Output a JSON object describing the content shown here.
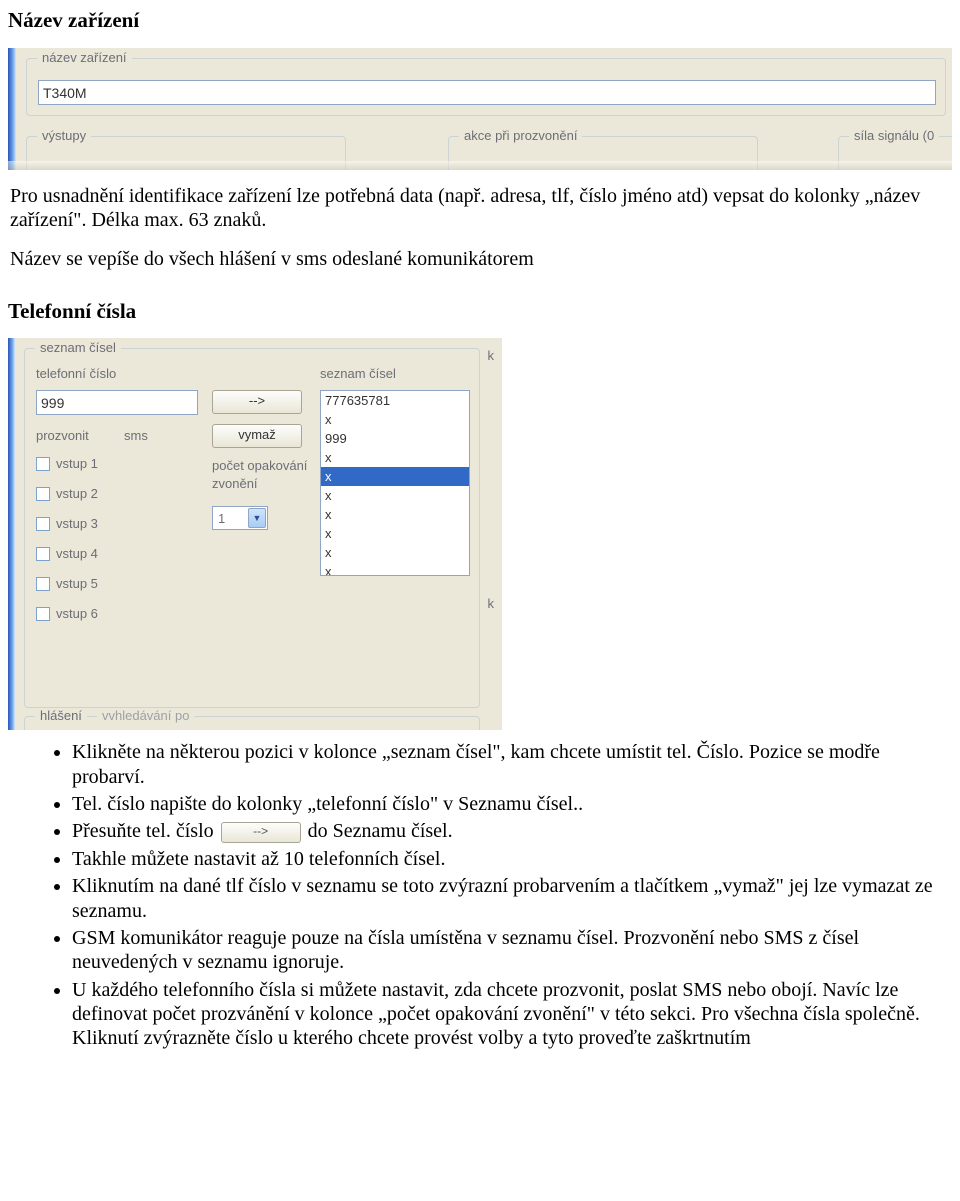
{
  "doc": {
    "h1": "Název zařízení",
    "p1": "Pro usnadnění identifikace zařízení lze potřebná data (např. adresa, tlf, číslo jméno atd) vepsat do kolonky „název zařízení\". Délka max. 63 znaků.",
    "p2": "Název se vepíše do všech hlášení v sms odeslané komunikátorem",
    "h2": "Telefonní čísla"
  },
  "shot1": {
    "group_label": "název zařízení",
    "device_name": "T340M",
    "group_outputs": "výstupy",
    "group_action": "akce při prozvonění",
    "group_signal": "síla signálu (0"
  },
  "shot2": {
    "group_label": "seznam čísel",
    "lbl_tel": "telefonní číslo",
    "lbl_list": "seznam čísel",
    "phone_input": "999",
    "lbl_call": "prozvonit",
    "lbl_sms": "sms",
    "btn_add": "-->",
    "btn_del": "vymaž",
    "lbl_repeat1": "počet opakování",
    "lbl_repeat2": "zvonění",
    "repeat_value": "1",
    "inputs": [
      "vstup 1",
      "vstup 2",
      "vstup 3",
      "vstup 4",
      "vstup 5",
      "vstup 6"
    ],
    "list": [
      "777635781",
      "x",
      "999",
      "x",
      "x",
      "x",
      "x",
      "x",
      "x",
      "x"
    ],
    "selected_index": 4,
    "lbl_bottom": "hlášení",
    "lbl_bottom2": "vvhledávání po",
    "right_k1": "k",
    "right_k2": "k"
  },
  "bullets": {
    "b1a": "Klikněte na některou pozici v kolonce „seznam čísel\", kam chcete umístit tel. Číslo. Pozice se modře probarví.",
    "b2": "Tel. číslo napište do kolonky „telefonní číslo\" v Seznamu čísel..",
    "b3_pre": "Přesuňte tel. číslo ",
    "b3_btn": "-->",
    "b3_post": " do  Seznamu čísel.",
    "b4": "Takhle můžete nastavit až 10 telefonních čísel.",
    "b5": "Kliknutím na dané tlf číslo v seznamu se toto zvýrazní probarvením a tlačítkem „vymaž\" jej lze vymazat ze seznamu.",
    "b6": "GSM komunikátor reaguje pouze na čísla umístěna v seznamu čísel. Prozvonění nebo SMS z čísel neuvedených v seznamu ignoruje.",
    "b7": "U každého telefonního čísla si můžete nastavit, zda chcete prozvonit, poslat SMS nebo obojí. Navíc lze definovat počet prozvánění v kolonce „počet opakování zvonění\" v této sekci. Pro všechna čísla společně. Kliknutí zvýrazněte číslo u kterého chcete provést volby a tyto proveďte zaškrtnutím"
  }
}
